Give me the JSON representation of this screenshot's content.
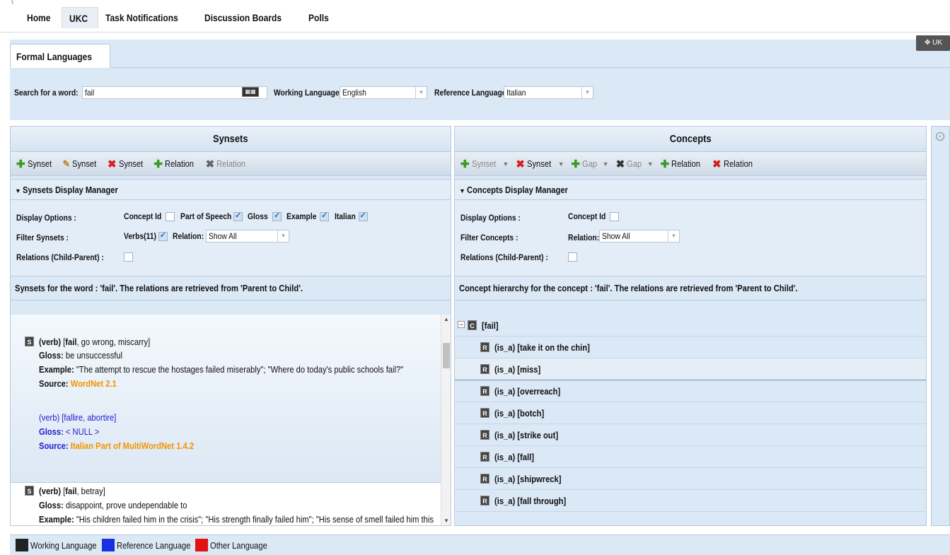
{
  "nav": {
    "items": [
      "Home",
      "UKC",
      "Task Notifications",
      "Discussion Boards",
      "Polls"
    ],
    "active_index": 1
  },
  "tab": {
    "label": "Formal Languages"
  },
  "top_right_button": {
    "label": "UK"
  },
  "search": {
    "label": "Search for a word:",
    "value": "fail",
    "working_language_label": "Working Language:",
    "working_language_value": "English",
    "reference_language_label": "Reference Language:",
    "reference_language_value": "Italian"
  },
  "synsets": {
    "title": "Synsets",
    "toolbar": {
      "add_synset": "Synset",
      "edit_synset": "Synset",
      "delete_synset": "Synset",
      "add_relation": "Relation",
      "delete_relation": "Relation"
    },
    "display_manager": {
      "title": "Synsets Display Manager",
      "display_options_label": "Display Options :",
      "concept_id": "Concept Id",
      "part_of_speech": "Part of Speech",
      "gloss": "Gloss",
      "example": "Example",
      "italian": "Italian",
      "filter_label": "Filter Synsets :",
      "verbs": "Verbs(11)",
      "relation_label": "Relation:",
      "relation_value": "Show All",
      "relations_child_parent": "Relations (Child-Parent) :"
    },
    "info": "Synsets for the word : 'fail'. The relations are retrieved from 'Parent to Child'.",
    "entries": [
      {
        "header_pos": "(verb)",
        "header_word": "fail",
        "header_rest": ", go wrong, miscarry]",
        "gloss_label": "Gloss:",
        "gloss": "be unsuccessful",
        "example_label": "Example:",
        "example": "\"The attempt to rescue the hostages failed miserably\"; \"Where do today's public schools fail?\"",
        "source_label": "Source:",
        "source": "WordNet 2.1",
        "ref_header": "(verb) [fallire, abortire]",
        "ref_gloss_label": "Gloss:",
        "ref_gloss": "< NULL >",
        "ref_source_label": "Source:",
        "ref_source": "Italian Part of MultiWordNet 1.4.2"
      },
      {
        "header_pos": "(verb)",
        "header_word": "fail",
        "header_rest": ", betray]",
        "gloss_label": "Gloss:",
        "gloss": "disappoint, prove undependable to",
        "example_label": "Example:",
        "example": "\"His children failed him in the crisis\"; \"His strength finally failed him\"; \"His sense of smell failed him this"
      }
    ]
  },
  "concepts": {
    "title": "Concepts",
    "toolbar": {
      "add_synset": "Synset",
      "delete_synset": "Synset",
      "add_gap": "Gap",
      "delete_gap": "Gap",
      "add_relation": "Relation",
      "delete_relation": "Relation"
    },
    "display_manager": {
      "title": "Concepts Display Manager",
      "display_options_label": "Display Options :",
      "concept_id": "Concept Id",
      "filter_label": "Filter Concepts :",
      "relation_label": "Relation:",
      "relation_value": "Show All",
      "relations_child_parent": "Relations (Child-Parent) :"
    },
    "info": "Concept hierarchy for the concept : 'fail'. The relations are retrieved from 'Parent to Child'.",
    "root": "[fail]",
    "children": [
      "(is_a) [take it on the chin]",
      "(is_a) [miss]",
      "(is_a) [overreach]",
      "(is_a) [botch]",
      "(is_a) [strike out]",
      "(is_a) [fall]",
      "(is_a) [shipwreck]",
      "(is_a) [fall through]"
    ],
    "selected_index": 1
  },
  "legend": {
    "working": "Working Language",
    "reference": "Reference Language",
    "other": "Other Language",
    "colors": {
      "working": "#222222",
      "reference": "#1a2fe0",
      "other": "#e31212"
    }
  }
}
